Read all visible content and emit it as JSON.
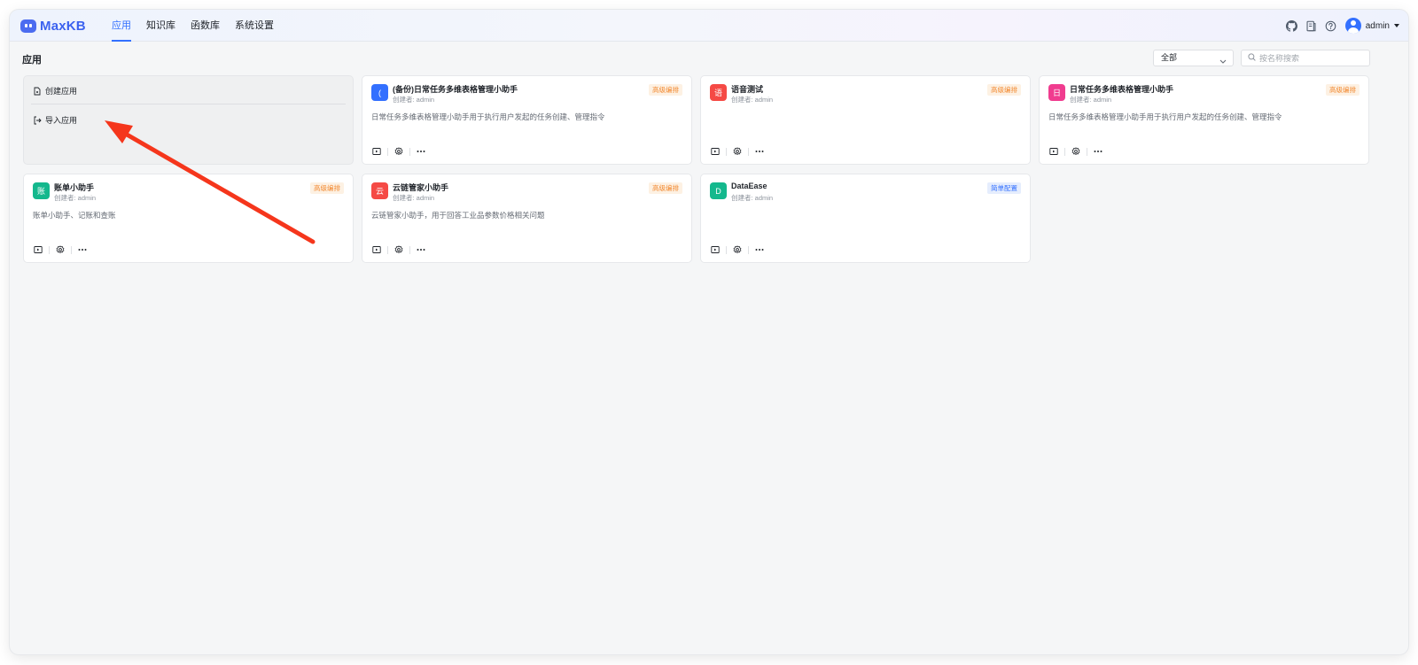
{
  "brand": {
    "name": "MaxKB"
  },
  "nav": {
    "items": [
      {
        "label": "应用",
        "active": true
      },
      {
        "label": "知识库",
        "active": false
      },
      {
        "label": "函数库",
        "active": false
      },
      {
        "label": "系统设置",
        "active": false
      }
    ]
  },
  "header_actions": {
    "icons": [
      "github-icon",
      "book-icon",
      "help-icon"
    ],
    "user": {
      "name": "admin"
    }
  },
  "page": {
    "title": "应用",
    "filter": {
      "selected": "全部"
    },
    "search": {
      "placeholder": "按名称搜索",
      "value": ""
    }
  },
  "create_card": {
    "create_label": "创建应用",
    "import_label": "导入应用"
  },
  "apps": [
    {
      "icon_letter": "(",
      "icon_color": "#3370ff",
      "name": "(备份)日常任务多维表格管理小助手",
      "creator": "创建者: admin",
      "tag": "高级编排",
      "tag_type": "advanced",
      "description": "日常任务多维表格管理小助手用于执行用户发起的任务创建、管理指令"
    },
    {
      "icon_letter": "语",
      "icon_color": "#f54a45",
      "name": "语音测试",
      "creator": "创建者: admin",
      "tag": "高级编排",
      "tag_type": "advanced",
      "description": ""
    },
    {
      "icon_letter": "日",
      "icon_color": "#f03c8f",
      "name": "日常任务多维表格管理小助手",
      "creator": "创建者: admin",
      "tag": "高级编排",
      "tag_type": "advanced",
      "description": "日常任务多维表格管理小助手用于执行用户发起的任务创建、管理指令"
    },
    {
      "icon_letter": "账",
      "icon_color": "#14b88d",
      "name": "账单小助手",
      "creator": "创建者: admin",
      "tag": "高级编排",
      "tag_type": "advanced",
      "description": "账单小助手、记账和查账"
    },
    {
      "icon_letter": "云",
      "icon_color": "#f54a45",
      "name": "云链管家小助手",
      "creator": "创建者: admin",
      "tag": "高级编排",
      "tag_type": "advanced",
      "description": "云链管家小助手，用于回答工业品参数价格相关问题"
    },
    {
      "icon_letter": "D",
      "icon_color": "#14b88d",
      "name": "DataEase",
      "creator": "创建者: admin",
      "tag": "简单配置",
      "tag_type": "simple",
      "description": ""
    }
  ],
  "colors": {
    "accent": "#3370ff",
    "annotation_arrow": "#f5361c"
  }
}
